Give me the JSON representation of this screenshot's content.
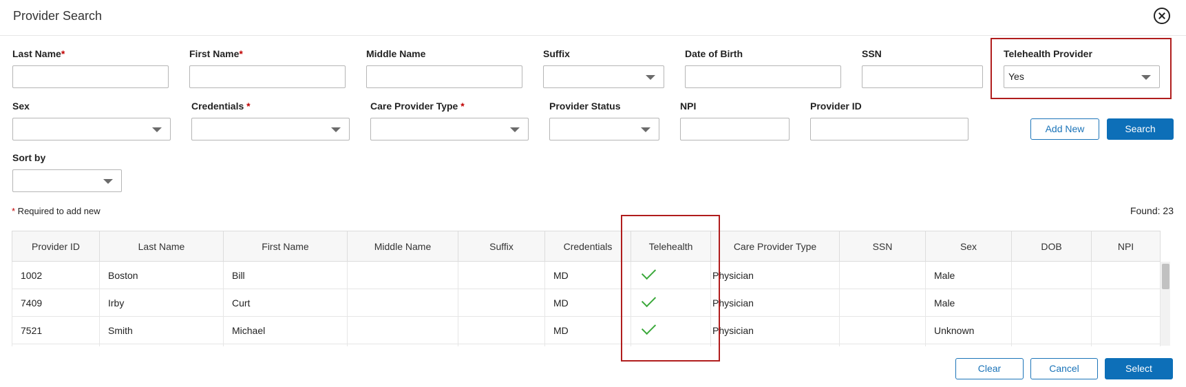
{
  "dialog": {
    "title": "Provider Search",
    "close_label": "close"
  },
  "form": {
    "last_name": {
      "label": "Last Name",
      "required": "*",
      "value": ""
    },
    "first_name": {
      "label": "First Name",
      "required": "*",
      "value": ""
    },
    "middle_name": {
      "label": "Middle Name",
      "value": ""
    },
    "suffix": {
      "label": "Suffix",
      "value": ""
    },
    "dob": {
      "label": "Date of Birth",
      "value": ""
    },
    "ssn": {
      "label": "SSN",
      "value": ""
    },
    "telehealth": {
      "label": "Telehealth Provider",
      "value": "Yes"
    },
    "sex": {
      "label": "Sex",
      "value": ""
    },
    "credentials": {
      "label": "Credentials ",
      "required": "*",
      "value": ""
    },
    "care_provider_type": {
      "label": "Care Provider Type ",
      "required": "*",
      "value": ""
    },
    "provider_status": {
      "label": "Provider Status",
      "value": ""
    },
    "npi": {
      "label": "NPI",
      "value": ""
    },
    "provider_id": {
      "label": "Provider ID",
      "value": ""
    },
    "sort_by": {
      "label": "Sort by",
      "value": ""
    }
  },
  "actions": {
    "add_new": "Add New",
    "search": "Search",
    "clear": "Clear",
    "cancel": "Cancel",
    "select": "Select"
  },
  "note": {
    "star": "*",
    "text": " Required to add new"
  },
  "found": "Found: 23",
  "table": {
    "headers": [
      "Provider ID",
      "Last Name",
      "First Name",
      "Middle Name",
      "Suffix",
      "Credentials",
      "Telehealth",
      "Care Provider Type",
      "SSN",
      "Sex",
      "DOB",
      "NPI"
    ],
    "rows": [
      {
        "provider_id": "1002",
        "last_name": "Boston",
        "first_name": "Bill",
        "middle_name": "",
        "suffix": "",
        "credentials": "MD",
        "telehealth": true,
        "care_provider_type": "Physician",
        "ssn": "",
        "sex": "Male",
        "dob": "",
        "npi": ""
      },
      {
        "provider_id": "7409",
        "last_name": "Irby",
        "first_name": "Curt",
        "middle_name": "",
        "suffix": "",
        "credentials": "MD",
        "telehealth": true,
        "care_provider_type": "Physician",
        "ssn": "",
        "sex": "Male",
        "dob": "",
        "npi": ""
      },
      {
        "provider_id": "7521",
        "last_name": "Smith",
        "first_name": "Michael",
        "middle_name": "",
        "suffix": "",
        "credentials": "MD",
        "telehealth": true,
        "care_provider_type": "Physician",
        "ssn": "",
        "sex": "Unknown",
        "dob": "",
        "npi": ""
      }
    ]
  },
  "colors": {
    "primary": "#0d6fb8",
    "highlight": "#b01c1c",
    "required": "#c00000",
    "check": "#3aa83a"
  },
  "icons": {
    "close": "close-circle-icon",
    "dropdown": "chevron-down-icon",
    "check": "check-icon"
  }
}
